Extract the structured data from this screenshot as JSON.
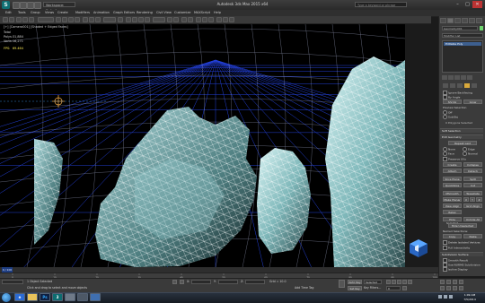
{
  "window": {
    "app_logo": "S",
    "workspace": "Workspace: Default",
    "title": "Autodesk 3ds Max  2015 x64",
    "search_placeholder": "Type a keyword or phrase",
    "minimize": "–",
    "maximize": "□",
    "close": "✕"
  },
  "menu": [
    "Edit",
    "Tools",
    "Group",
    "Views",
    "Create",
    "Modifiers",
    "Animation",
    "Graph Editors",
    "Rendering",
    "Civil View",
    "Customize",
    "MAXScript",
    "Help"
  ],
  "viewport": {
    "label": "[+] [Camera001] [Shaded + Edged Faces]",
    "stats": [
      {
        "label": "Total",
        "value": ""
      },
      {
        "label": "Polys:",
        "value": "31,884"
      },
      {
        "label": "Verts:",
        "value": "16,271"
      },
      {
        "label": "FPS:",
        "value": "69.464"
      }
    ]
  },
  "command_panel": {
    "object_name": "Geometry001",
    "modifier_list": "Modifier List",
    "stack_item": "Editable Poly",
    "options": [
      "Ignore Backfacing",
      "By Angle",
      "Shrink",
      "Grow",
      "Preview Selection",
      "Off",
      "SubObj",
      "Multi"
    ],
    "selection_status": "0 Polygons Selected",
    "soft_selection": "Soft Selection",
    "edit_geometry": "Edit Geometry",
    "repeat_last": "Repeat Last",
    "constraints": [
      "None",
      "Edge",
      "Face",
      "Normal"
    ],
    "preserve_uvs": "Preserve UVs",
    "create": "Create",
    "collapse": "Collapse",
    "attach": "Attach",
    "detach": "Detach",
    "slice_plane": "Slice Plane",
    "split": "Split",
    "quickslice": "QuickSlice",
    "cut": "Cut",
    "msmooth": "MSmooth",
    "tessellate": "Tessellate",
    "make_planar": "Make Planar",
    "axes": [
      "X",
      "Y",
      "Z"
    ],
    "view_align": "View Align",
    "grid_align": "Grid Align",
    "relax": "Relax",
    "hide_selected": "Hide Selected",
    "unhide_all": "Unhide All",
    "hide_unselected": "Hide Unselected",
    "named_selections": "Named Selections:",
    "copy": "Copy",
    "paste": "Paste",
    "delete_isolated": "Delete Isolated Vertices",
    "full_interactivity": "Full Interactivity",
    "subdivision_surface": "Subdivision Surface",
    "smooth_result": "Smooth Result",
    "use_nurms": "Use NURMS Subdivision",
    "isoline_display": "Isoline Display"
  },
  "timeline": {
    "frame": "0 / 100",
    "ticks": [
      "0",
      "10",
      "20",
      "30",
      "40",
      "50",
      "60",
      "70",
      "80",
      "90",
      "100"
    ]
  },
  "status": {
    "selected": "1 Object Selected",
    "prompt": "Click and drag to select and move objects",
    "x_label": "X:",
    "y_label": "Y:",
    "z_label": "Z:",
    "grid": "Grid = 10.0",
    "auto_key": "Auto Key",
    "key_mode": "Selected",
    "set_key": "Set Key",
    "key_filters": "Key Filters...",
    "add_time_tag": "Add Time Tag",
    "frame_field": "0"
  },
  "taskbar": {
    "apps": [
      "e",
      "",
      "Ps",
      "3",
      "",
      "",
      ""
    ],
    "time": "1:09 AM",
    "date": "7/5/2014"
  },
  "colors": {
    "rock_highlight": "#cfeef0",
    "wire": "#ffffff",
    "grid": "#2a4cff",
    "viewport_bg": "#000000"
  }
}
